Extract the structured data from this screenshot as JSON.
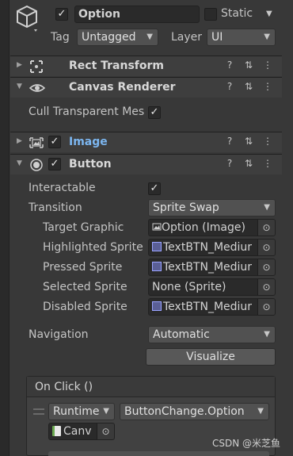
{
  "gameobject": {
    "name": "Option",
    "static_label": "Static",
    "tag_label": "Tag",
    "tag_value": "Untagged",
    "layer_label": "Layer",
    "layer_value": "UI",
    "active_check": "✓"
  },
  "components": {
    "rect_transform": "Rect Transform",
    "canvas_renderer": "Canvas Renderer",
    "cull_label": "Cull Transparent Mes",
    "image": "Image",
    "button": "Button"
  },
  "button": {
    "interactable_label": "Interactable",
    "transition_label": "Transition",
    "transition_value": "Sprite Swap",
    "target_graphic_label": "Target Graphic",
    "target_graphic_value": "Option (Image)",
    "highlighted_label": "Highlighted Sprite",
    "highlighted_value": "TextBTN_Mediur",
    "pressed_label": "Pressed Sprite",
    "pressed_value": "TextBTN_Mediur",
    "selected_label": "Selected Sprite",
    "selected_value": "None (Sprite)",
    "disabled_label": "Disabled Sprite",
    "disabled_value": "TextBTN_Mediur",
    "navigation_label": "Navigation",
    "navigation_value": "Automatic",
    "visualize_label": "Visualize"
  },
  "onclick": {
    "title": "On Click ()",
    "runtime_value": "Runtime",
    "function_value": "ButtonChange.Option",
    "object_value": "Canv"
  },
  "watermark": "CSDN @米芝鱼",
  "icons": {
    "help": "?",
    "presets": "⇅",
    "menu": "⋮",
    "picker": "⊙",
    "dropdown": "▼"
  }
}
